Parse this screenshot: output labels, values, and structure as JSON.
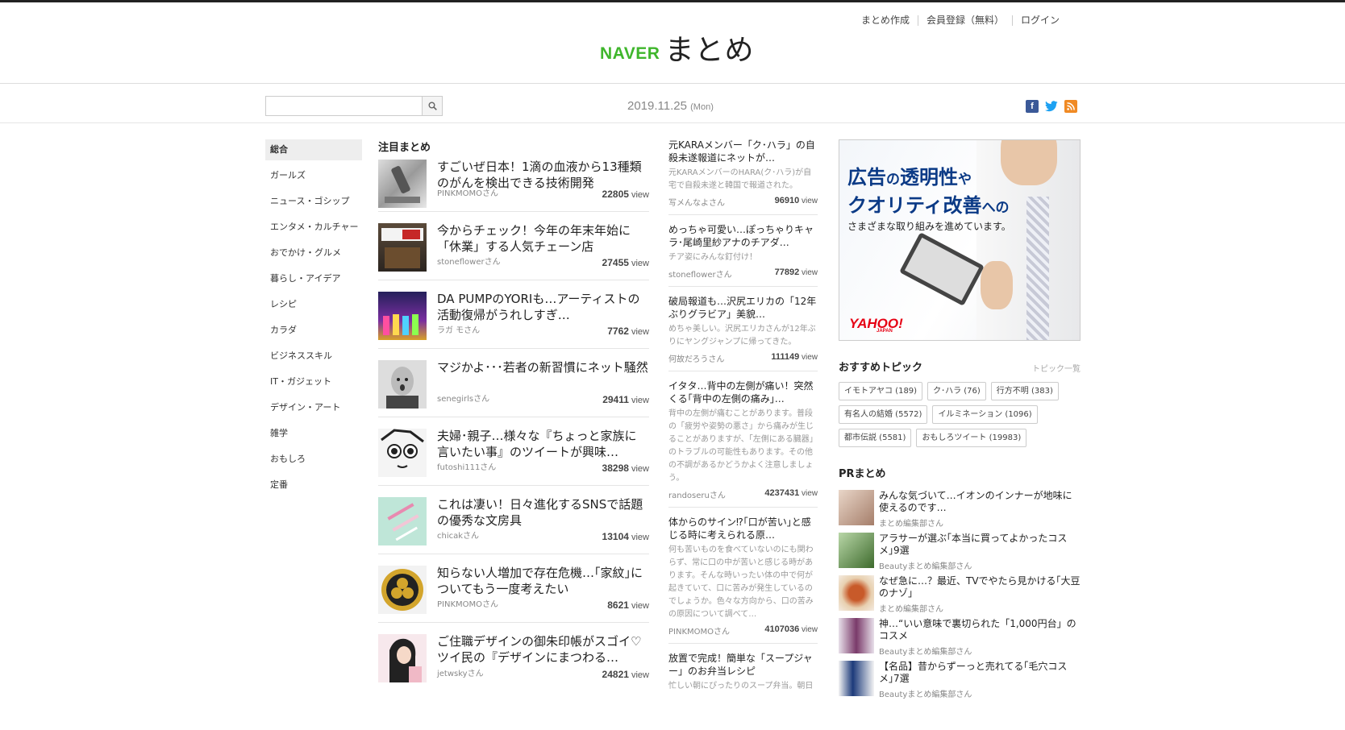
{
  "header": {
    "logo_naver": "NAVER",
    "logo_matome": "まとめ",
    "links": [
      "まとめ作成",
      "会員登録（無料）",
      "ログイン"
    ]
  },
  "subbar": {
    "search_placeholder": "",
    "date": "2019.11.25",
    "weekday": "(Mon)"
  },
  "social_icons": [
    "facebook-icon",
    "twitter-icon",
    "rss-icon"
  ],
  "sidebar": {
    "items": [
      "総合",
      "ガールズ",
      "ニュース・ゴシップ",
      "エンタメ・カルチャー",
      "おでかけ・グルメ",
      "暮らし・アイデア",
      "レシピ",
      "カラダ",
      "ビジネススキル",
      "IT・ガジェット",
      "デザイン・アート",
      "雑学",
      "おもしろ",
      "定番"
    ],
    "active": "総合"
  },
  "main": {
    "section_title": "注目まとめ",
    "view_label": "view",
    "articles": [
      {
        "title": "すごいぜ日本！1滴の血液から13種類のがんを検出できる技術開発",
        "author": "PINKMOMOさん",
        "views": "22805"
      },
      {
        "title": "今からチェック！今年の年末年始に「休業」する人気チェーン店",
        "author": "stoneflowerさん",
        "views": "27455"
      },
      {
        "title": "DA PUMPのYORIも…アーティストの活動復帰がうれしすぎ…",
        "author": "ラガ モさん",
        "views": "7762"
      },
      {
        "title": "マジかよ･･･若者の新習慣にネット騒然",
        "author": "senegirlsさん",
        "views": "29411"
      },
      {
        "title": "夫婦･親子…様々な『ちょっと家族に言いたい事』のツイートが興味…",
        "author": "futoshi111さん",
        "views": "38298"
      },
      {
        "title": "これは凄い！日々進化するSNSで話題の優秀な文房具",
        "author": "chicakさん",
        "views": "13104"
      },
      {
        "title": "知らない人増加で存在危機…｢家紋｣についてもう一度考えたい",
        "author": "PINKMOMOさん",
        "views": "8621"
      },
      {
        "title": "ご住職デザインの御朱印帳がスゴイ♡ツイ民の『デザインにまつわる…",
        "author": "jetwskyさん",
        "views": "24821"
      }
    ]
  },
  "middle": {
    "items": [
      {
        "title": "元KARAメンバー「ク･ハラ」の自殺未遂報道にネットが…",
        "desc": "元KARAメンバーのHARA(ク･ハラ)が自宅で自殺未遂と韓国で報道された。",
        "author": "写メんなよさん",
        "views": "96910"
      },
      {
        "title": "めっちゃ可愛い…ぽっちゃりキャラ･尾崎里紗アナのチアダ…",
        "desc": "チア姿にみんな釘付け！",
        "author": "stoneflowerさん",
        "views": "77892"
      },
      {
        "title": "破局報道も…沢尻エリカの「12年ぶりグラビア」美貌…",
        "desc": "めちゃ美しい。沢尻エリカさんが12年ぶりにヤングジャンプに帰ってきた。",
        "author": "何故だろうさん",
        "views": "111149"
      },
      {
        "title": "イタタ…背中の左側が痛い！突然くる｢背中の左側の痛み｣…",
        "desc": "背中の左側が痛むことがあります。普段の「疲労や姿勢の悪さ」から痛みが生じることがありますが、「左側にある臓器」のトラブルの可能性もあります。その他の不調があるかどうかよく注意しましょう。",
        "author": "randoseruさん",
        "views": "4237431"
      },
      {
        "title": "体からのサイン⁉｢口が苦い｣と感じる時に考えられる原…",
        "desc": "何も苦いものを食べていないのにも関わらず、常に口の中が苦いと感じる時があります。そんな時いったい体の中で何が起きていて、口に苦みが発生しているのでしょうか。色々な方向から、口の苦みの原因について調べて…",
        "author": "PINKMOMOさん",
        "views": "4107036"
      },
      {
        "title": "放置で完成！簡単な「スープジャー」のお弁当レシピ",
        "desc": "忙しい朝にぴったりのスープ弁当。朝日",
        "author": "",
        "views": ""
      }
    ]
  },
  "right": {
    "ad": {
      "line1_a": "広告",
      "line1_b": "の",
      "line1_c": "透明性",
      "line1_d": "や",
      "line2_a": "クオリティ改善",
      "line2_b": "への",
      "sub": "さまざまな取り組みを進めています。",
      "brand": "YAHOO!",
      "brand_sub": "JAPAN"
    },
    "topics_title": "おすすめトピック",
    "topics_more": "トピック一覧",
    "topics": [
      "イモトアヤコ (189)",
      "ク･ハラ (76)",
      "行方不明 (383)",
      "有名人の結婚 (5572)",
      "イルミネーション (1096)",
      "都市伝説 (5581)",
      "おもしろツイート (19983)"
    ],
    "pr_title": "PRまとめ",
    "pr_items": [
      {
        "title": "みんな気づいて…イオンのインナーが地味に使えるのです…",
        "source": "まとめ編集部さん"
      },
      {
        "title": "アラサーが選ぶ｢本当に買ってよかったコスメ｣9選",
        "source": "Beautyまとめ編集部さん"
      },
      {
        "title": "なぜ急に…？最近、TVでやたら見かける｢大豆のナゾ｣",
        "source": "まとめ編集部さん"
      },
      {
        "title": "神…“いい意味で裏切られた「1,000円台」のコスメ",
        "source": "Beautyまとめ編集部さん"
      },
      {
        "title": "【名品】昔からずーっと売れてる｢毛穴コスメ｣7選",
        "source": "Beautyまとめ編集部さん"
      }
    ]
  }
}
